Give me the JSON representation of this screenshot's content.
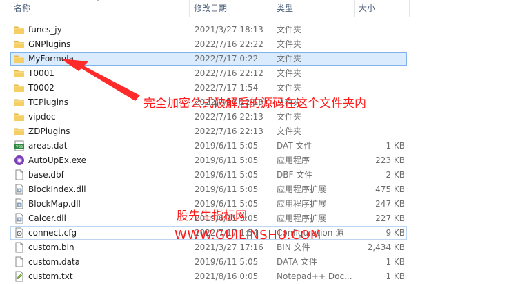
{
  "columns": {
    "name": "名称",
    "modified": "修改日期",
    "type": "类型",
    "size": "大小"
  },
  "files": [
    {
      "name": "funcs_jy",
      "modified": "2021/3/27 18:13",
      "type": "文件夹",
      "size": "",
      "icon": "folder-icon"
    },
    {
      "name": "GNPlugins",
      "modified": "2022/7/16 22:22",
      "type": "文件夹",
      "size": "",
      "icon": "folder-icon"
    },
    {
      "name": "MyFormula",
      "modified": "2022/7/17 0:22",
      "type": "文件夹",
      "size": "",
      "icon": "folder-icon",
      "selected": true
    },
    {
      "name": "T0001",
      "modified": "2022/7/16 22:12",
      "type": "文件夹",
      "size": "",
      "icon": "folder-icon"
    },
    {
      "name": "T0002",
      "modified": "2022/7/17 1:54",
      "type": "文件夹",
      "size": "",
      "icon": "folder-icon"
    },
    {
      "name": "TCPlugins",
      "modified": "2022/7/16 22:13",
      "type": "文件夹",
      "size": "",
      "icon": "folder-icon"
    },
    {
      "name": "vipdoc",
      "modified": "2022/7/16 22:13",
      "type": "文件夹",
      "size": "",
      "icon": "folder-icon"
    },
    {
      "name": "ZDPlugins",
      "modified": "2022/7/16 22:13",
      "type": "文件夹",
      "size": "",
      "icon": "folder-icon"
    },
    {
      "name": "areas.dat",
      "modified": "2019/6/11 5:05",
      "type": "DAT 文件",
      "size": "1 KB",
      "icon": "dat-file-icon"
    },
    {
      "name": "AutoUpEx.exe",
      "modified": "2019/6/11 5:05",
      "type": "应用程序",
      "size": "223 KB",
      "icon": "exe-app-icon"
    },
    {
      "name": "base.dbf",
      "modified": "2019/6/11 5:05",
      "type": "DBF 文件",
      "size": "2 KB",
      "icon": "blank-file-icon"
    },
    {
      "name": "BlockIndex.dll",
      "modified": "2019/6/11 5:05",
      "type": "应用程序扩展",
      "size": "475 KB",
      "icon": "dll-file-icon"
    },
    {
      "name": "BlockMap.dll",
      "modified": "2019/6/11 5:05",
      "type": "应用程序扩展",
      "size": "247 KB",
      "icon": "dll-file-icon"
    },
    {
      "name": "Calcer.dll",
      "modified": "2019/6/11 5:05",
      "type": "应用程序扩展",
      "size": "227 KB",
      "icon": "dll-file-icon"
    },
    {
      "name": "connect.cfg",
      "modified": "2022/7/17 1:54",
      "type": "Configuration 源",
      "size": "9 KB",
      "icon": "config-file-icon",
      "focus": true
    },
    {
      "name": "custom.bin",
      "modified": "2021/3/27 17:16",
      "type": "BIN 文件",
      "size": "2,434 KB",
      "icon": "blank-file-icon"
    },
    {
      "name": "custom.data",
      "modified": "2019/6/11 5:05",
      "type": "DATA 文件",
      "size": "1 KB",
      "icon": "blank-file-icon"
    },
    {
      "name": "custom.txt",
      "modified": "2021/8/16 0:05",
      "type": "Notepad++ Doc...",
      "size": "1 KB",
      "icon": "notepad-file-icon"
    }
  ],
  "annotation": {
    "text": "完全加密公式破解后的源码在这个文件夹内",
    "color": "#ff1a1a"
  },
  "watermark": {
    "line1": "股先生指标网",
    "line2": "WWW.GUILINSHU.COM",
    "color": "#ff1a1a"
  }
}
